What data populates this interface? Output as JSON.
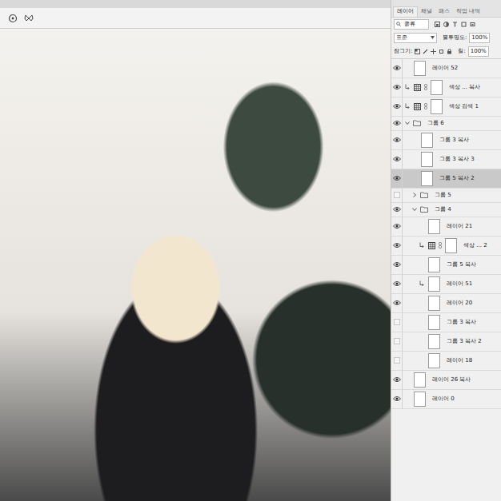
{
  "panel_tabs": [
    {
      "label": "레이어",
      "selected": true
    },
    {
      "label": "채널",
      "selected": false
    },
    {
      "label": "패스",
      "selected": false
    },
    {
      "label": "작업 내역",
      "selected": false
    }
  ],
  "filter": {
    "label": "종류"
  },
  "blend": {
    "mode": "표준",
    "opacity_label": "불투명도:",
    "opacity": "100%"
  },
  "lock": {
    "label": "잠그기:",
    "fill_label": "칠:",
    "fill": "100%"
  },
  "layers": [
    {
      "name": "레이어 52",
      "kind": "layer",
      "visible": true,
      "selected": false,
      "clipped": false
    },
    {
      "name": "색상 ... 복사",
      "kind": "adjustment",
      "visible": true,
      "selected": false,
      "clipped": true
    },
    {
      "name": "색상 검색 1",
      "kind": "adjustment",
      "visible": true,
      "selected": false,
      "clipped": true
    },
    {
      "name": "그룹 6",
      "kind": "group",
      "visible": true,
      "selected": false,
      "clipped": false,
      "expanded": true,
      "children": [
        {
          "name": "그룹 3 복사",
          "kind": "layer",
          "visible": true,
          "selected": false,
          "clipped": false
        },
        {
          "name": "그룹 3 복사 3",
          "kind": "layer",
          "visible": true,
          "selected": false,
          "clipped": false
        },
        {
          "name": "그룹 5 복사 2",
          "kind": "layer",
          "visible": true,
          "selected": true,
          "clipped": false
        },
        {
          "name": "그룹 5",
          "kind": "group",
          "visible": false,
          "selected": false,
          "clipped": false,
          "expanded": false,
          "children": []
        },
        {
          "name": "그룹 4",
          "kind": "group",
          "visible": true,
          "selected": false,
          "clipped": false,
          "expanded": true,
          "children": [
            {
              "name": "레이어 21",
              "kind": "layer",
              "visible": true,
              "selected": false,
              "clipped": false
            },
            {
              "name": "색상 ... 2",
              "kind": "adjustment",
              "visible": true,
              "selected": false,
              "clipped": true
            },
            {
              "name": "그룹 5 복사",
              "kind": "layer",
              "visible": true,
              "selected": false,
              "clipped": false
            },
            {
              "name": "레이어 51",
              "kind": "layer",
              "visible": true,
              "selected": false,
              "clipped": true
            },
            {
              "name": "레이어 20",
              "kind": "layer",
              "visible": true,
              "selected": false,
              "clipped": false
            },
            {
              "name": "그룹 3 복사",
              "kind": "layer",
              "visible": false,
              "selected": false,
              "clipped": false
            },
            {
              "name": "그룹 3 복사 2",
              "kind": "layer",
              "visible": false,
              "selected": false,
              "clipped": false
            },
            {
              "name": "레이어 18",
              "kind": "layer",
              "visible": false,
              "selected": false,
              "clipped": false
            }
          ]
        }
      ]
    },
    {
      "name": "레이어 26 복사",
      "kind": "layer",
      "visible": true,
      "selected": false,
      "clipped": false
    },
    {
      "name": "레이어 0",
      "kind": "layer",
      "visible": true,
      "selected": false,
      "clipped": false
    }
  ]
}
